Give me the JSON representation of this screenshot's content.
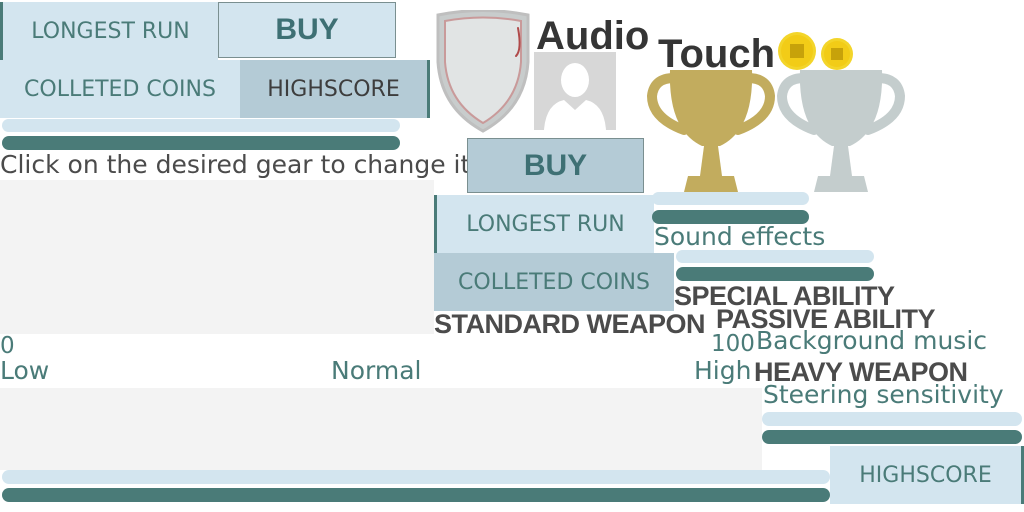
{
  "top_left": {
    "longest_run": "LONGEST RUN",
    "buy": "BUY",
    "collected_coins": "COLLETED COINS",
    "highscore": "HIGHSCORE"
  },
  "instruction": "Click on the desired gear to change it",
  "center": {
    "buy": "BUY",
    "longest_run": "LONGEST RUN",
    "collected_coins": "COLLETED COINS"
  },
  "title": {
    "part1": "Audio",
    "part2": "Touch"
  },
  "weapons": {
    "standard": "STANDARD WEAPON",
    "special": "SPECIAL ABILITY",
    "passive": "PASSIVE ABILITY",
    "heavy": "HEAVY WEAPON"
  },
  "settings": {
    "sound_effects": "Sound effects",
    "background_music": "Background music",
    "steering_sensitivity": "Steering sensitivity"
  },
  "slider": {
    "min": "0",
    "max": "100",
    "low": "Low",
    "normal": "Normal",
    "high": "High"
  },
  "bottom_right": {
    "highscore": "HIGHSCORE"
  },
  "colors": {
    "teal": "#4a7b78",
    "light_blue": "#d3e5ef",
    "mid_blue": "#b4cbd6",
    "gold": "#c2ac5e",
    "silver": "#c4cdcd"
  },
  "icons": [
    "shield-icon",
    "avatar-icon",
    "coin-icon",
    "gold-trophy-icon",
    "silver-trophy-icon"
  ]
}
